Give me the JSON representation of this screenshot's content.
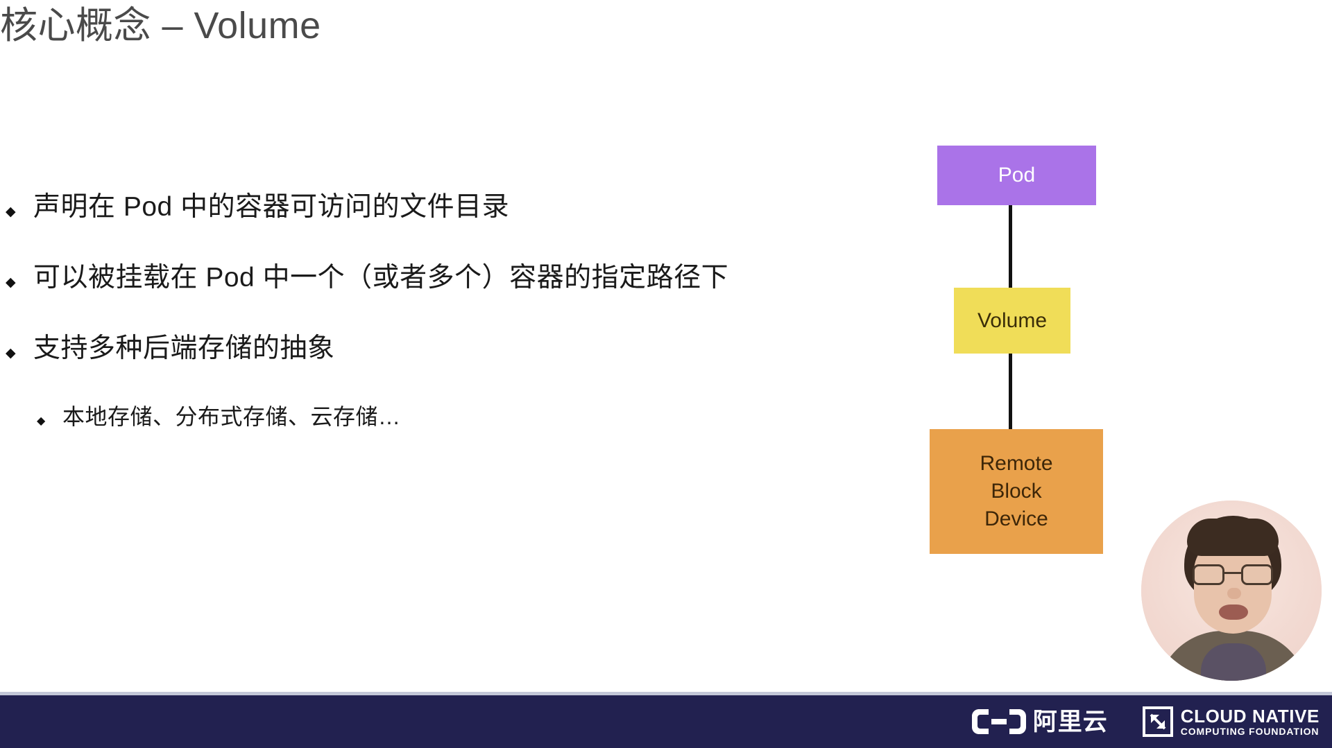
{
  "slide": {
    "title": "核心概念 – Volume",
    "bullets": [
      {
        "level": 1,
        "marker": "◆",
        "text": "声明在 Pod 中的容器可访问的文件目录"
      },
      {
        "level": 1,
        "marker": "◆",
        "text": "可以被挂载在 Pod 中一个（或者多个）容器的指定路径下"
      },
      {
        "level": 1,
        "marker": "◆",
        "text": "支持多种后端存储的抽象"
      },
      {
        "level": 2,
        "marker": "◆",
        "text": "本地存储、分布式存储、云存储…"
      }
    ]
  },
  "diagram": {
    "nodes": [
      {
        "id": "pod",
        "label": "Pod",
        "color": "#aa73e8",
        "text_color": "#ffffff"
      },
      {
        "id": "volume",
        "label": "Volume",
        "color": "#f0dd58",
        "text_color": "#3a2d08"
      },
      {
        "id": "remote_block_device",
        "label": "Remote\nBlock\nDevice",
        "line1": "Remote",
        "line2": "Block",
        "line3": "Device",
        "color": "#e9a14b",
        "text_color": "#3d2608"
      }
    ],
    "connectors": [
      {
        "from": "pod",
        "to": "volume",
        "color": "#111111"
      },
      {
        "from": "volume",
        "to": "remote_block_device",
        "color": "#111111"
      }
    ]
  },
  "footer": {
    "background": "#222150",
    "aliyun": {
      "name": "阿里云",
      "icon": "aliyun-bracket-icon"
    },
    "cncf": {
      "line1": "CLOUD NATIVE",
      "line2": "COMPUTING FOUNDATION",
      "icon": "cncf-mark-icon"
    }
  },
  "webcam": {
    "present": true,
    "shape": "circle"
  },
  "colors": {
    "title": "#4a4a4a",
    "body_text": "#1a1a1a",
    "background": "#ffffff",
    "footer_bar": "#222150",
    "footer_divider": "#c3c7d8"
  }
}
